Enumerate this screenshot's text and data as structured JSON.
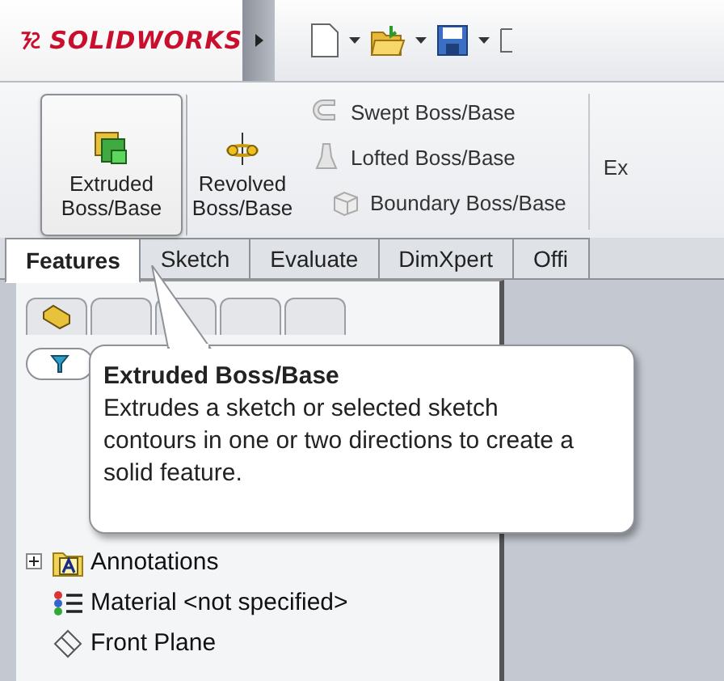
{
  "app": {
    "logo": "SOLIDWORKS"
  },
  "ribbon": {
    "large_buttons": [
      {
        "label": "Extruded Boss/Base",
        "kind": "extrude",
        "selected": true
      },
      {
        "label": "Revolved Boss/Base",
        "kind": "revolve",
        "selected": false
      }
    ],
    "small_buttons": [
      {
        "label": "Swept Boss/Base",
        "kind": "swept"
      },
      {
        "label": "Lofted Boss/Base",
        "kind": "lofted"
      },
      {
        "label": "Boundary Boss/Base",
        "kind": "boundary"
      }
    ],
    "cut_label": "Ex"
  },
  "tabs": [
    {
      "label": "Features",
      "selected": true
    },
    {
      "label": "Sketch",
      "selected": false
    },
    {
      "label": "Evaluate",
      "selected": false
    },
    {
      "label": "DimXpert",
      "selected": false
    },
    {
      "label": "Offi",
      "selected": false
    }
  ],
  "tree": {
    "items": [
      {
        "label": "Annotations",
        "kind": "annotations",
        "expanded": false
      },
      {
        "label": "Material <not specified>",
        "kind": "material"
      },
      {
        "label": "Front Plane",
        "kind": "plane"
      }
    ]
  },
  "tooltip": {
    "title": "Extruded Boss/Base",
    "text": "Extrudes a sketch or selected sketch contours in one or two directions to create a solid feature."
  }
}
